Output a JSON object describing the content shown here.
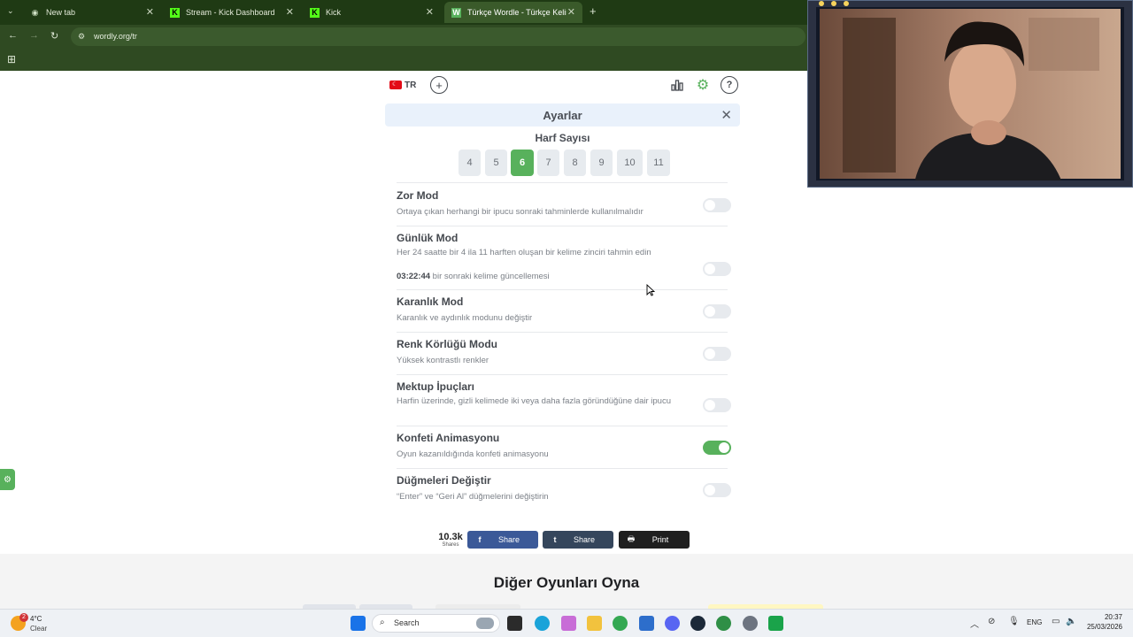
{
  "browser": {
    "tabs": [
      {
        "label": "New tab",
        "active": false
      },
      {
        "label": "Stream - Kick Dashboard",
        "active": false
      },
      {
        "label": "Kick",
        "active": false
      },
      {
        "label": "Türkçe Wordle - Türkçe Kelime",
        "active": true
      }
    ],
    "new_tab_glyph": "+",
    "url": "wordly.org/tr"
  },
  "game": {
    "lang_code": "TR",
    "settings_title": "Ayarlar",
    "letter_count_title": "Harf Sayısı",
    "letter_counts": [
      "4",
      "5",
      "6",
      "7",
      "8",
      "9",
      "10",
      "11"
    ],
    "selected_count": "6",
    "settings": [
      {
        "title": "Zor Mod",
        "desc": "Ortaya çıkan herhangi bir ipucu sonraki tahminlerde kullanılmalıdır",
        "on": false
      },
      {
        "title": "Günlük Mod",
        "desc": "Her 24 saatte bir 4 ila 11 harften oluşan bir kelime zinciri tahmin edin",
        "timer": "03:22:44",
        "timer_suffix": "bir sonraki kelime güncellemesi",
        "on": false
      },
      {
        "title": "Karanlık Mod",
        "desc": "Karanlık ve aydınlık modunu değiştir",
        "on": false
      },
      {
        "title": "Renk Körlüğü Modu",
        "desc": "Yüksek kontrastlı renkler",
        "on": false
      },
      {
        "title": "Mektup İpuçları",
        "desc": "Harfin üzerinde, gizli kelimede iki veya daha fazla göründüğüne dair ipucu",
        "on": false
      },
      {
        "title": "Konfeti Animasyonu",
        "desc": "Oyun kazanıldığında konfeti animasyonu",
        "on": true
      },
      {
        "title": "Düğmeleri Değiştir",
        "desc": "“Enter” ve “Geri Al” düğmelerini değiştirin",
        "on": false
      }
    ],
    "shares_count": "10.3k",
    "shares_label": "Shares",
    "share_buttons": [
      {
        "label": "Share",
        "icon": "facebook-icon",
        "color": "#3b5998"
      },
      {
        "label": "Share",
        "icon": "tumblr-icon",
        "color": "#35465c"
      },
      {
        "label": "Print",
        "icon": "print-icon",
        "color": "#1f1f1f"
      }
    ],
    "other_games_title": "Diğer Oyunları Oyna"
  },
  "taskbar": {
    "weather_temp": "4°C",
    "weather_desc": "Clear",
    "weather_badge": "2",
    "search_placeholder": "Search",
    "lang": "ENG",
    "time": "20:37",
    "date": "25/03/2026"
  },
  "colors": {
    "accent_green": "#58b15c",
    "chrome_dark": "#1f3a14",
    "chrome_toolbar": "#2f4a22"
  }
}
